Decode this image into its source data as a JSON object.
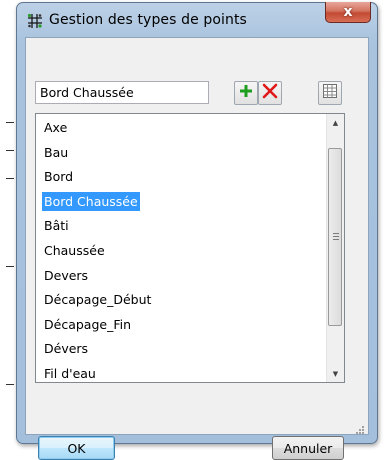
{
  "window": {
    "title": "Gestion des types de points",
    "close_label": "x"
  },
  "name_field": {
    "value": "Bord Chaussée"
  },
  "toolbar": {
    "add_icon": "plus-icon",
    "delete_icon": "red-x-icon",
    "table_icon": "grid-icon"
  },
  "point_types": {
    "items": [
      {
        "label": "Axe"
      },
      {
        "label": "Bau"
      },
      {
        "label": "Bord"
      },
      {
        "label": "Bord Chaussée",
        "selected": true
      },
      {
        "label": "Bâti"
      },
      {
        "label": "Chaussée"
      },
      {
        "label": "Devers"
      },
      {
        "label": "Décapage_Début"
      },
      {
        "label": "Décapage_Fin"
      },
      {
        "label": "Dévers"
      },
      {
        "label": "Fil d'eau"
      }
    ]
  },
  "buttons": {
    "ok_label": "OK",
    "cancel_label": "Annuler"
  },
  "colors": {
    "selection": "#3399ff",
    "add_green": "#1f9d1f",
    "delete_red": "#e01818",
    "close_red": "#c24a33"
  }
}
